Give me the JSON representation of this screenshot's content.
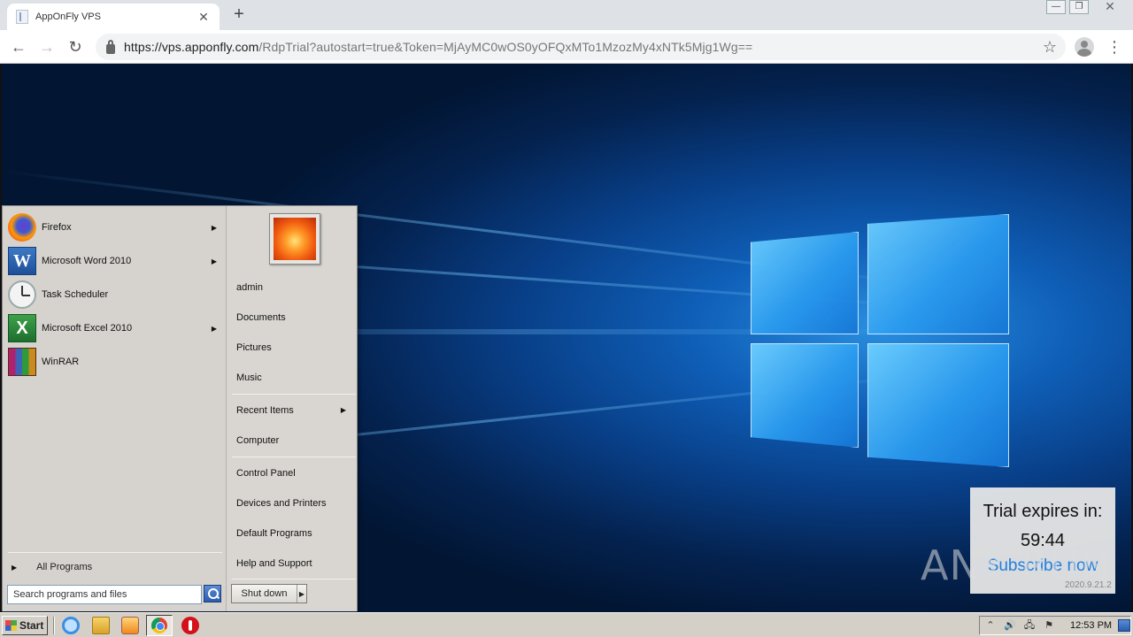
{
  "browser": {
    "tab_title": "AppOnFly VPS",
    "tab_close": "✕",
    "new_tab": "+",
    "url_host": "https://vps.apponfly.com",
    "url_rest": "/RdpTrial?autostart=true&Token=MjAyMC0wOS0yOFQxMTo1MzozMy4xNTk5Mjg1Wg==",
    "back": "←",
    "forward": "→",
    "reload": "↻",
    "star": "☆",
    "menu": "⋮",
    "window_controls": {
      "minimize": "—",
      "restore": "❐",
      "close": "✕"
    }
  },
  "start_menu": {
    "programs": [
      {
        "label": "Firefox",
        "icon": "firefox-icon",
        "submenu": true
      },
      {
        "label": "Microsoft Word 2010",
        "icon": "word-icon",
        "submenu": true
      },
      {
        "label": "Task Scheduler",
        "icon": "task-scheduler-icon",
        "submenu": false
      },
      {
        "label": "Microsoft Excel 2010",
        "icon": "excel-icon",
        "submenu": true
      },
      {
        "label": "WinRAR",
        "icon": "winrar-icon",
        "submenu": false
      }
    ],
    "word_glyph": "W",
    "excel_glyph": "X",
    "all_programs": "All Programs",
    "search_placeholder": "Search programs and files",
    "right_items": [
      {
        "label": "admin"
      },
      {
        "label": "Documents"
      },
      {
        "label": "Pictures"
      },
      {
        "label": "Music"
      },
      {
        "label": "Recent Items",
        "submenu": true
      },
      {
        "label": "Computer"
      },
      {
        "label": "Control Panel"
      },
      {
        "label": "Devices and Printers"
      },
      {
        "label": "Default Programs"
      },
      {
        "label": "Help and Support"
      }
    ],
    "shutdown": "Shut down",
    "arrow": "▶"
  },
  "trial": {
    "title": "Trial expires in:",
    "time": "59:44",
    "link": "Subscribe now",
    "watermark": "ANY RUN",
    "version": "2020.9.21.2"
  },
  "taskbar": {
    "start_label": "Start",
    "tray": {
      "expand": "⌃",
      "volume": "🔊",
      "network": "🖧",
      "flag": "⚑"
    },
    "time": "12:53 PM"
  }
}
